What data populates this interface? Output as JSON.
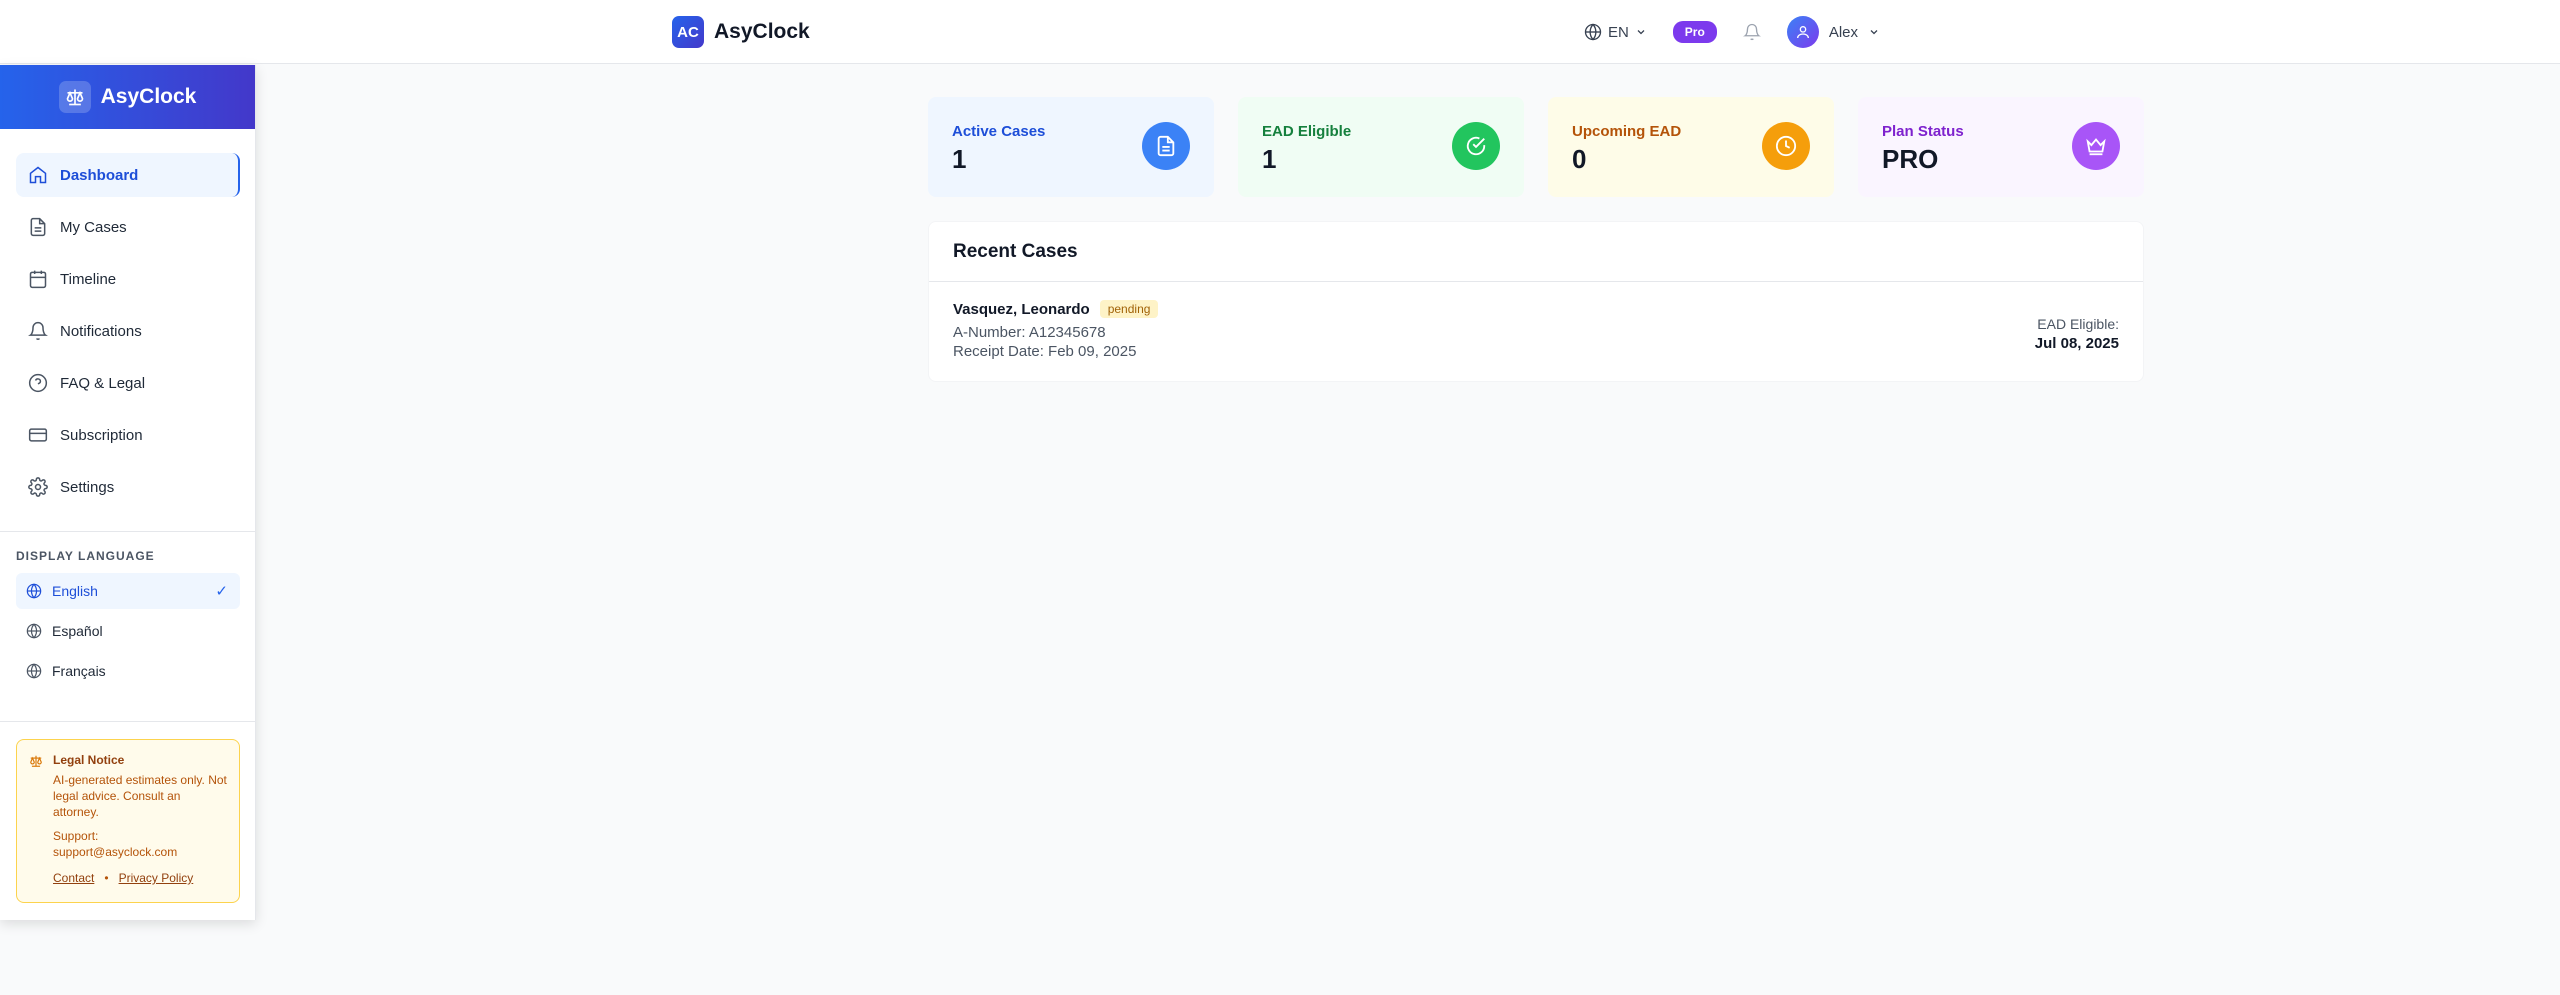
{
  "header": {
    "logo_text": "AC",
    "brand": "AsyClock",
    "language": "EN",
    "plan_badge": "Pro",
    "user_name": "Alex"
  },
  "sidebar": {
    "brand": "AsyClock",
    "items": [
      {
        "label": "Dashboard",
        "icon": "home-icon",
        "active": true
      },
      {
        "label": "My Cases",
        "icon": "document-icon"
      },
      {
        "label": "Timeline",
        "icon": "calendar-icon"
      },
      {
        "label": "Notifications",
        "icon": "bell-icon"
      },
      {
        "label": "FAQ & Legal",
        "icon": "help-circle-icon"
      },
      {
        "label": "Subscription",
        "icon": "credit-card-icon"
      },
      {
        "label": "Settings",
        "icon": "gear-icon"
      }
    ],
    "language_title": "DISPLAY LANGUAGE",
    "languages": [
      {
        "label": "English",
        "active": true
      },
      {
        "label": "Español"
      },
      {
        "label": "Français"
      }
    ],
    "legal": {
      "title": "Legal Notice",
      "text": "AI-generated estimates only. Not legal advice. Consult an attorney.",
      "support_label": "Support:",
      "support_email": "support@asyclock.com",
      "contact": "Contact",
      "separator": "•",
      "privacy": "Privacy Policy"
    }
  },
  "stats": [
    {
      "label": "Active Cases",
      "value": "1",
      "icon": "document-icon",
      "color": "#3b82f6"
    },
    {
      "label": "EAD Eligible",
      "value": "1",
      "icon": "check-circle-icon",
      "color": "#22c55e"
    },
    {
      "label": "Upcoming EAD",
      "value": "0",
      "icon": "clock-icon",
      "color": "#f59e0b"
    },
    {
      "label": "Plan Status",
      "value": "PRO",
      "icon": "crown-icon",
      "color": "#a855f7"
    }
  ],
  "recent_cases": {
    "title": "Recent Cases",
    "cases": [
      {
        "name": "Vasquez, Leonardo",
        "status": "pending",
        "a_number": "A-Number: A12345678",
        "receipt_date": "Receipt Date: Feb 09, 2025",
        "ead_label": "EAD Eligible:",
        "ead_date": "Jul 08, 2025"
      }
    ]
  }
}
